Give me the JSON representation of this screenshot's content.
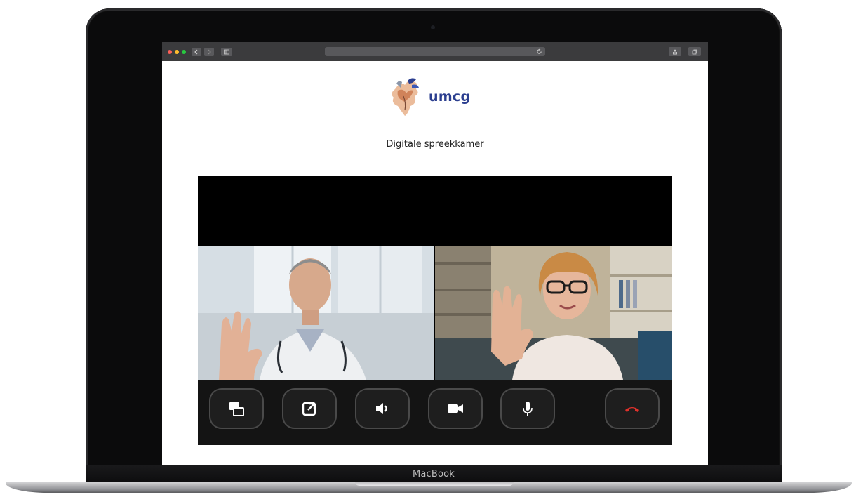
{
  "device": {
    "brand_label": "MacBook"
  },
  "browser": {
    "traffic_lights": [
      "#ff5f57",
      "#febc2e",
      "#28c840"
    ]
  },
  "page": {
    "logo_text": "umcg",
    "title": "Digitale spreekkamer",
    "accent_color": "#2b3e8f"
  },
  "video_call": {
    "controls": [
      {
        "name": "switch-layout",
        "icon": "layout-icon"
      },
      {
        "name": "popout",
        "icon": "external-link-icon"
      },
      {
        "name": "speaker",
        "icon": "speaker-icon"
      },
      {
        "name": "camera",
        "icon": "video-camera-icon"
      },
      {
        "name": "microphone",
        "icon": "microphone-icon"
      },
      {
        "name": "hang-up",
        "icon": "phone-hangup-icon",
        "color": "#e0312b"
      }
    ]
  }
}
